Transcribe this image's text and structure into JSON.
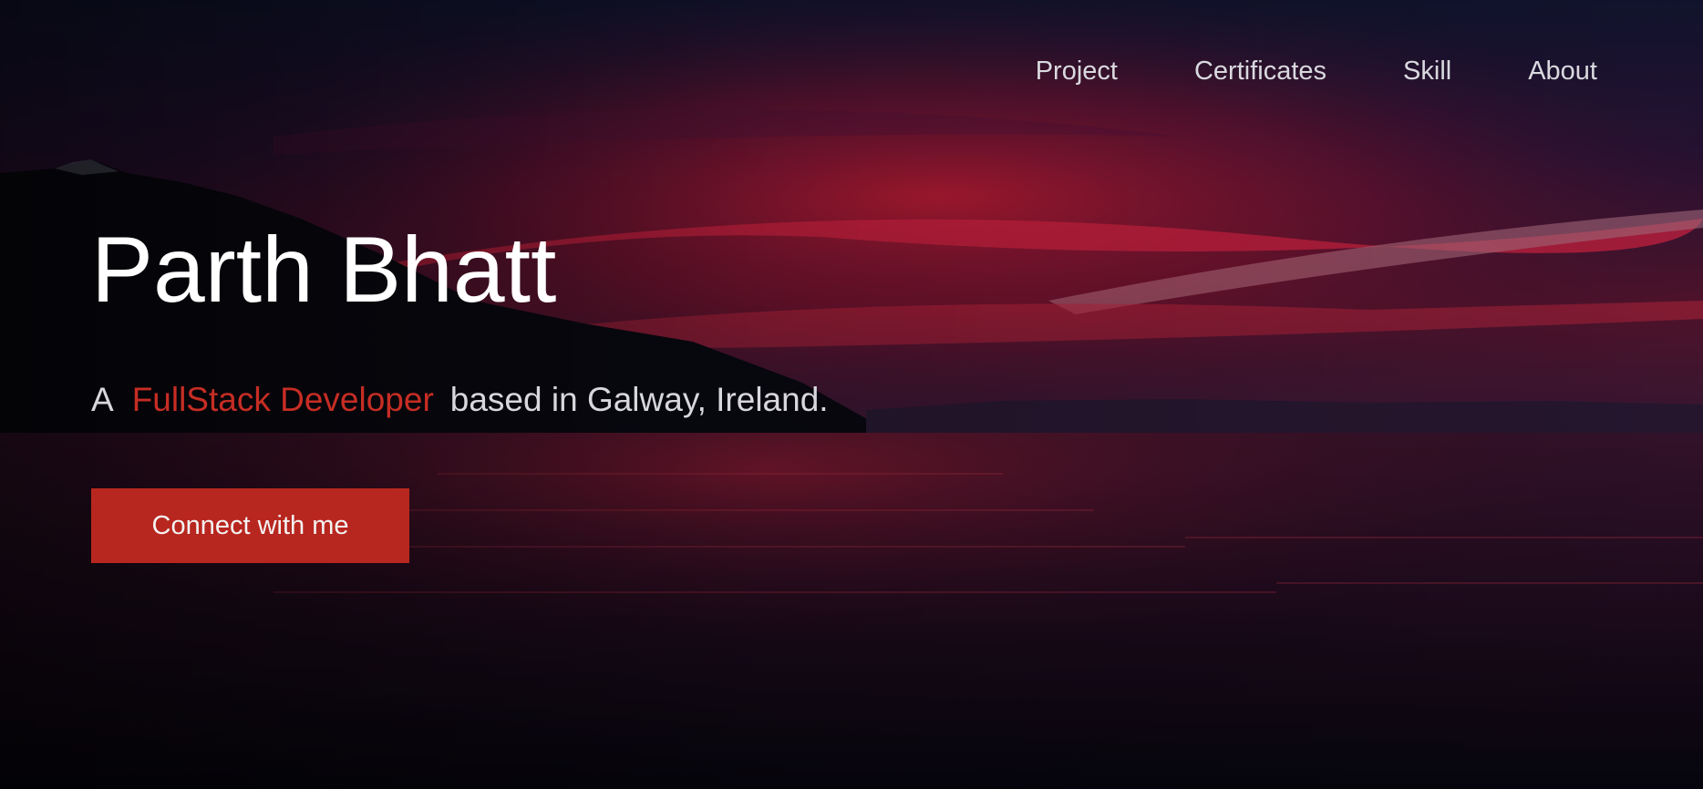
{
  "nav": {
    "items": [
      {
        "label": "Project"
      },
      {
        "label": "Certificates"
      },
      {
        "label": "Skill"
      },
      {
        "label": "About"
      }
    ]
  },
  "hero": {
    "name": "Parth Bhatt",
    "tagline_prefix": "A",
    "tagline_highlight": "FullStack Developer",
    "tagline_suffix": "based in Galway, Ireland.",
    "cta_label": "Connect with me"
  },
  "colors": {
    "accent": "#c62d24",
    "button": "#b8271f",
    "heading": "#ffffff",
    "nav_text": "#d9d9df"
  }
}
